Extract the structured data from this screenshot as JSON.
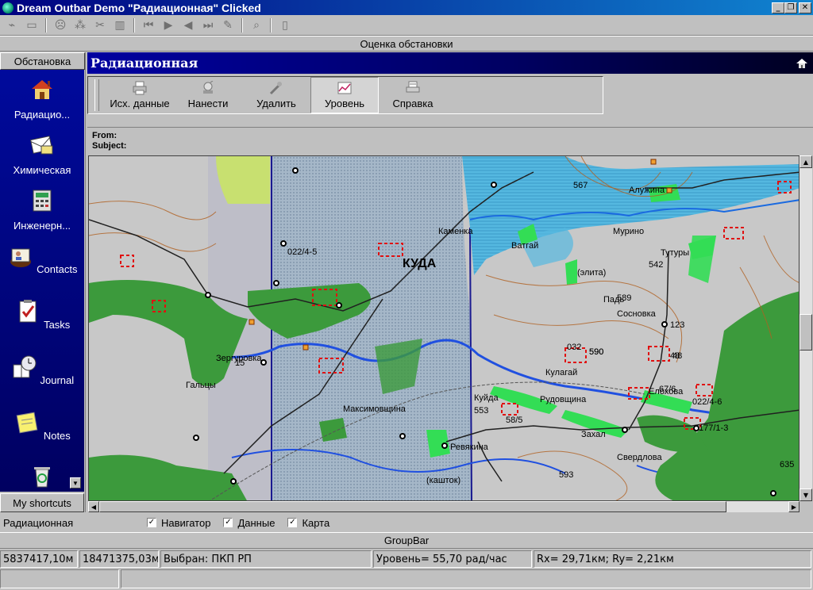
{
  "window": {
    "title": "Dream Outbar Demo \"Радиационная\" Clicked",
    "buttons": [
      "_",
      "❐",
      "✕"
    ]
  },
  "toolbar": {
    "icons": [
      "open-icon",
      "folder-icon",
      "face-icon",
      "network-icon",
      "cut-icon",
      "trash-icon",
      "first-icon",
      "next-icon",
      "prev-icon",
      "last-icon",
      "edit-icon",
      "search-icon",
      "bookmark-icon"
    ]
  },
  "section_header": "Оценка обстановки",
  "outbar": {
    "header": "Обстановка",
    "items": [
      {
        "label": "Радиацио...",
        "icon": "house-icon"
      },
      {
        "label": "Химическая",
        "icon": "envelope-icon"
      },
      {
        "label": "Инженерн...",
        "icon": "calculator-icon"
      },
      {
        "label": "Contacts",
        "icon": "contacts-icon"
      },
      {
        "label": "Tasks",
        "icon": "tasks-icon"
      },
      {
        "label": "Journal",
        "icon": "journal-icon"
      },
      {
        "label": "Notes",
        "icon": "notes-icon"
      },
      {
        "label": "",
        "icon": "recycle-icon"
      }
    ],
    "footer": "My shortcuts"
  },
  "pane": {
    "title": "Радиационная",
    "ribbon": [
      {
        "label": "Исх. данные",
        "active": false
      },
      {
        "label": "Нанести",
        "active": false
      },
      {
        "label": "Удалить",
        "active": false
      },
      {
        "label": "Уровень",
        "active": true
      },
      {
        "label": "Справка",
        "active": false
      }
    ],
    "from_label": "From:",
    "subject_label": "Subject:"
  },
  "map": {
    "labels": [
      "КУДА",
      "Алужина",
      "Тутуры",
      "Сосновка",
      "Рудовщина",
      "Захал",
      "Свердлова",
      "Максимовщина",
      "Ревякина",
      "Кулагай",
      "Гальцы",
      "Ватгай",
      "Мурино",
      "Елохова",
      "Куйда",
      "Зергуровка",
      "Каменка",
      "Падь",
      "(элита)",
      "(кашток)",
      "590",
      "593",
      "542",
      "567",
      "589",
      "553",
      "48",
      "590",
      "635",
      "177/1-3",
      "022/4-6",
      "67/6",
      "58/5",
      "022/4-5",
      "032",
      "15",
      "123",
      "48"
    ],
    "colors": {
      "terrain": "#c8c8c8",
      "forest": "#3c9a3c",
      "bright_green": "#33dd55",
      "water": "#3ea8d8",
      "contour": "#b06020",
      "road": "#202020",
      "zone": "#1a1a90",
      "marker": "#e01010"
    }
  },
  "options": {
    "current": "Радиационная",
    "checks": [
      {
        "label": "Навигатор",
        "checked": true
      },
      {
        "label": "Данные",
        "checked": true
      },
      {
        "label": "Карта",
        "checked": true
      }
    ]
  },
  "groupbar": "GroupBar",
  "status": {
    "x": "5837417,10м",
    "y": "18471375,03м",
    "selected": "Выбран: ПКП РП",
    "level": "Уровень= 55,70 рад/час",
    "rxry": "Rx= 29,71км;  Ry= 2,21км"
  }
}
